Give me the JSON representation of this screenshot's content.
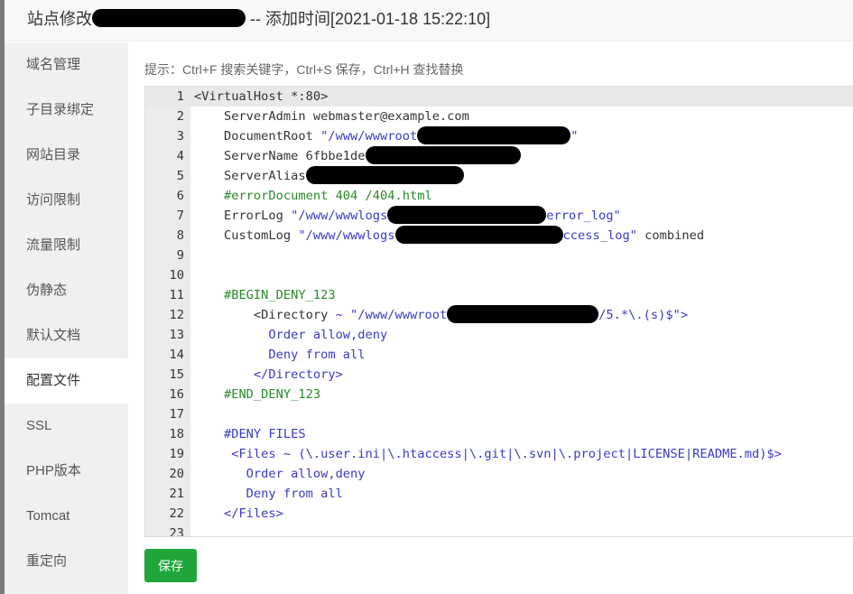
{
  "title": {
    "prefix": "站点修改",
    "suffix": " -- 添加时间[2021-01-18 15:22:10]"
  },
  "sidebar": {
    "items": [
      {
        "label": "域名管理"
      },
      {
        "label": "子目录绑定"
      },
      {
        "label": "网站目录"
      },
      {
        "label": "访问限制"
      },
      {
        "label": "流量限制"
      },
      {
        "label": "伪静态"
      },
      {
        "label": "默认文档"
      },
      {
        "label": "配置文件",
        "active": true
      },
      {
        "label": "SSL"
      },
      {
        "label": "PHP版本"
      },
      {
        "label": "Tomcat"
      },
      {
        "label": "重定向"
      }
    ]
  },
  "hint": "提示：Ctrl+F 搜索关键字，Ctrl+S 保存，Ctrl+H 查找替换",
  "editor": {
    "lines": [
      [
        {
          "t": "<VirtualHost *:80>"
        }
      ],
      [
        {
          "t": "    ServerAdmin webmaster@example.com"
        }
      ],
      [
        {
          "t": "    DocumentRoot "
        },
        {
          "t": "\"/www/wwwroot",
          "c": "str"
        },
        {
          "r": 1
        },
        {
          "t": "\"",
          "c": "str"
        }
      ],
      [
        {
          "t": "    ServerName 6fbbe1de"
        },
        {
          "r": 1
        }
      ],
      [
        {
          "t": "    ServerAlias"
        },
        {
          "r": 1
        }
      ],
      [
        {
          "t": "    #errorDocument 404 /404.html",
          "c": "com"
        }
      ],
      [
        {
          "t": "    ErrorLog "
        },
        {
          "t": "\"/www/wwwlogs",
          "c": "str"
        },
        {
          "r": 1
        },
        {
          "t": "error_log\"",
          "c": "str"
        }
      ],
      [
        {
          "t": "    CustomLog "
        },
        {
          "t": "\"/www/wwwlogs",
          "c": "str"
        },
        {
          "r": 1
        },
        {
          "t": "ccess_log\"",
          "c": "str"
        },
        {
          "t": " combined"
        }
      ],
      [],
      [],
      [
        {
          "t": "    #BEGIN_DENY_123",
          "c": "com"
        }
      ],
      [
        {
          "t": "        <Directory "
        },
        {
          "t": "~ \"/www/wwwroot",
          "c": "str"
        },
        {
          "r": 1
        },
        {
          "t": "/5.*\\.(s)$\">",
          "c": "str"
        }
      ],
      [
        {
          "t": "          Order allow,deny",
          "c": "kw"
        }
      ],
      [
        {
          "t": "          Deny from all",
          "c": "kw"
        }
      ],
      [
        {
          "t": "        </Directory>",
          "c": "kw"
        }
      ],
      [
        {
          "t": "    #END_DENY_123",
          "c": "com"
        }
      ],
      [],
      [
        {
          "t": "    #DENY FILES",
          "c": "kw"
        }
      ],
      [
        {
          "t": "     <Files ~ (\\.user.ini|\\.htaccess|\\.git|\\.svn|\\.project|LICENSE|README.md)$>",
          "c": "kw"
        }
      ],
      [
        {
          "t": "       Order allow,deny",
          "c": "kw"
        }
      ],
      [
        {
          "t": "       Deny from all",
          "c": "kw"
        }
      ],
      [
        {
          "t": "    </Files>",
          "c": "kw"
        }
      ],
      []
    ]
  },
  "save_label": "保存",
  "colors": {
    "accent": "#20a53a",
    "string": "#3a3ac4",
    "comment": "#2b8a2b"
  }
}
